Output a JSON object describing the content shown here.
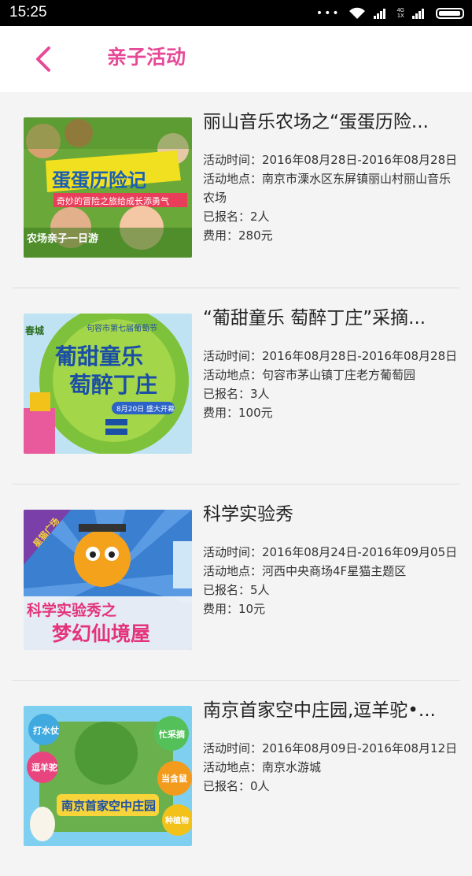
{
  "status_bar": {
    "time": "15:25",
    "network_label_top": "4G",
    "network_label_bottom": "1X"
  },
  "header": {
    "title": "亲子活动",
    "back_icon": "chevron-left-icon"
  },
  "colors": {
    "accent": "#e64a97",
    "header_bg": "#ffffff",
    "list_bg": "#f4f4f4",
    "text": "#333333"
  },
  "labels": {
    "time": "活动时间：",
    "place": "活动地点：",
    "signed": "已报名：",
    "fee": "费用："
  },
  "activities": [
    {
      "title": "丽山音乐农场之“蛋蛋历险...",
      "time": "2016年08月28日-2016年08月28日",
      "place": "南京市溧水区东屏镇丽山村丽山音乐农场",
      "signed": "2人",
      "fee": "280元",
      "poster": {
        "headline": "蛋蛋历险记",
        "subline": "奇妙的冒险之旅给成长添勇气",
        "footer": "农场亲子一日游"
      }
    },
    {
      "title": "“葡甜童乐 萄醉丁庄”采摘...",
      "time": "2016年08月28日-2016年08月28日",
      "place": "句容市茅山镇丁庄老方葡萄园",
      "signed": "3人",
      "fee": "100元",
      "poster": {
        "top": "句容市第七届葡萄节",
        "line1": "葡甜童乐",
        "line2": "萄醉丁庄",
        "badge": "8月20日 盛大开幕",
        "corner": "春城"
      }
    },
    {
      "title": "科学实验秀",
      "time": "2016年08月24日-2016年09月05日",
      "place": "河西中央商场4F星猫主题区",
      "signed": "5人",
      "fee": "10元",
      "poster": {
        "corner": "星猫广场",
        "line1": "科学实验秀之",
        "line2": "梦幻仙境屋"
      }
    },
    {
      "title": "南京首家空中庄园,逗羊驼•...",
      "time": "2016年08月09日-2016年08月12日",
      "place": "南京水游城",
      "signed": "0人",
      "fee": "",
      "poster": {
        "bubbles": [
          "打水仗",
          "逗羊驼",
          "忙采摘",
          "当含鼠",
          "种植物"
        ],
        "banner": "南京首家空中庄园"
      }
    }
  ]
}
